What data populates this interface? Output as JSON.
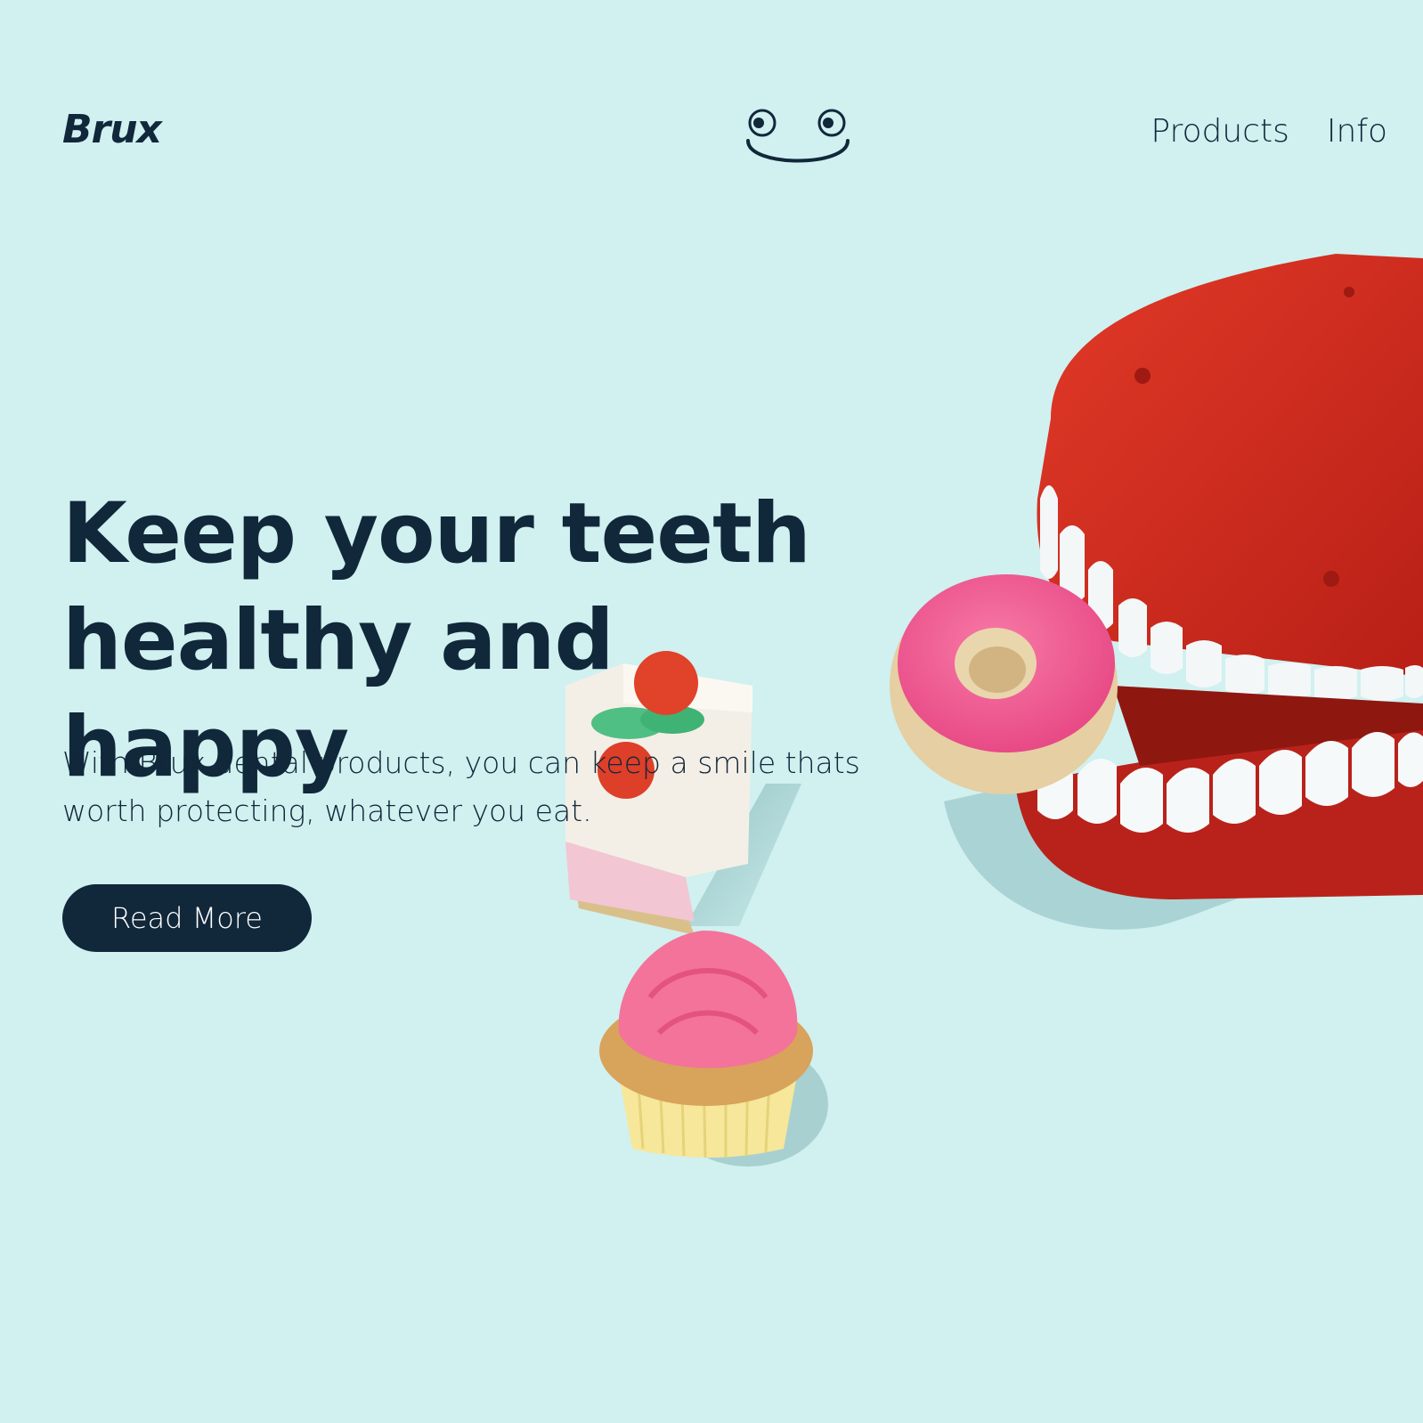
{
  "brand": {
    "name": "Brux",
    "mascot_icon": "smiley-face-icon"
  },
  "nav": {
    "items": [
      {
        "label": "Products"
      },
      {
        "label": "Info"
      }
    ]
  },
  "hero": {
    "headline_line1": "Keep your teeth",
    "headline_line2": "healthy and happy",
    "subtext": "With Brux dental products, you can keep a smile thats worth protecting, whatever you eat.",
    "cta_label": "Read More"
  },
  "colors": {
    "background": "#d1f0f0",
    "ink": "#11273a",
    "button_text": "#ffffff"
  }
}
